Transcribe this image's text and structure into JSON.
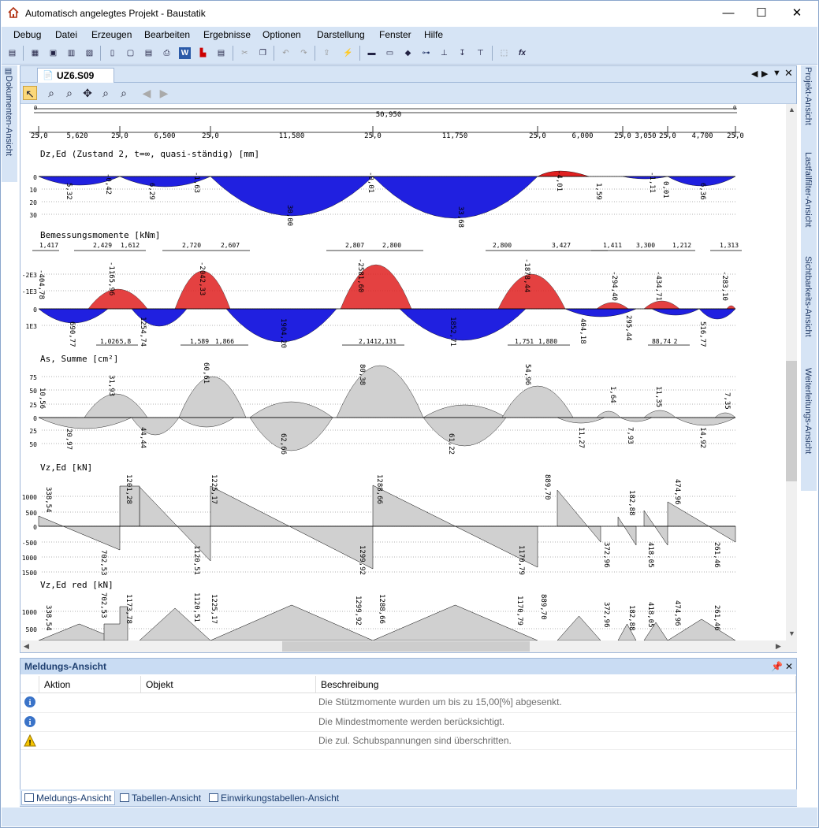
{
  "window": {
    "title": "Automatisch angelegtes Projekt - Baustatik",
    "minimize": "—",
    "maximize": "☐",
    "close": "✕"
  },
  "menu": [
    "Debug",
    "Datei",
    "Erzeugen",
    "Bearbeiten",
    "Ergebnisse",
    "Optionen",
    "Darstellung",
    "Fenster",
    "Hilfe"
  ],
  "side_tabs": {
    "left": "Dokumenten-Ansicht",
    "right": [
      "Projekt-Ansicht",
      "Lastfallfilter-Ansicht",
      "Sichtbarkeits-Ansicht",
      "Weiterleitungs-Ansicht"
    ]
  },
  "doc": {
    "tab": "UZ6.S09"
  },
  "diagram": {
    "span_total": "50,950",
    "spans": [
      "25,0",
      "5,620",
      "25,0",
      "6,500",
      "25,0",
      "11,580",
      "25,0",
      "11,750",
      "25,0",
      "6,000",
      "25,0",
      "3,050",
      "25,0",
      "4,700",
      "25,0"
    ],
    "dz": {
      "title": "Dz,Ed (Zustand 2, t=∞, quasi-ständig) [mm]",
      "ticks": [
        "0",
        "10",
        "20",
        "30"
      ],
      "labels": [
        "5,32",
        "-0,42",
        "6,29",
        "-1,63",
        "30,00",
        "-0,01",
        "33,68",
        "-4,01",
        "1,59",
        "-1,11",
        "0,01",
        "6,36"
      ]
    },
    "moment": {
      "title": "Bemessungsmomente [kNm]",
      "ticks": [
        "-2E3",
        "-1E3",
        "0",
        "1E3"
      ],
      "dims_top": [
        "1,417",
        "2,429",
        "1,612",
        "2,720",
        "2,607",
        "2,807",
        "2,800",
        "2,800",
        "3,427",
        "1,411",
        "3,300",
        "1,212",
        "1,313"
      ],
      "dims_bottom": [
        "1,026",
        "5,8",
        "1,589",
        "1,866",
        "2,141",
        "2,131",
        "1,751",
        "1,880",
        "88,74",
        "2"
      ],
      "labels": [
        "-404,78",
        "690,77",
        "-1165,96",
        "1254,74",
        "-2042,33",
        "1904,20",
        "-2581,60",
        "1852,71",
        "-1878,44",
        "404,18",
        "-294,40",
        "295,44",
        "-434,71",
        "516,77",
        "-283,10"
      ]
    },
    "as": {
      "title": "As, Summe [cm²]",
      "ticks": [
        "75",
        "50",
        "25",
        "0",
        "25",
        "50"
      ],
      "labels": [
        "10,56",
        "20,97",
        "31,93",
        "44,44",
        "60,61",
        "62,66",
        "80,38",
        "61,22",
        "54,96",
        "11,27",
        "1,64",
        "7,93",
        "11,35",
        "14,92",
        "7,35"
      ]
    },
    "vz": {
      "title": "Vz,Ed [kN]",
      "ticks": [
        "1000",
        "500",
        "0",
        "-500",
        "1000",
        "1500"
      ],
      "labels": [
        "338,54",
        "702,53",
        "1201,28",
        "1120,51",
        "1225,17",
        "1288,66",
        "1299,92",
        "889,70",
        "1170,79",
        "182,88",
        "372,96",
        "418,05",
        "474,96",
        "261,46"
      ]
    },
    "vzred": {
      "title": "Vz,Ed red [kN]",
      "ticks": [
        "1000",
        "500"
      ],
      "labels": [
        "338,54",
        "702,53",
        "1173,78",
        "1120,51",
        "1225,17",
        "1299,92",
        "1288,66",
        "1170,79",
        "889,70",
        "372,96",
        "182,88",
        "418,05",
        "474,96",
        "261,46"
      ]
    }
  },
  "messages": {
    "title": "Meldungs-Ansicht",
    "columns": [
      "Aktion",
      "Objekt",
      "Beschreibung"
    ],
    "rows": [
      {
        "icon": "info-icon",
        "text": "Die Stützmomente wurden um bis zu 15,00[%] abgesenkt."
      },
      {
        "icon": "info-icon",
        "text": "Die Mindestmomente werden berücksichtigt."
      },
      {
        "icon": "warning-icon",
        "text": "Die zul. Schubspannungen sind überschritten."
      }
    ]
  },
  "bottom_tabs": [
    "Meldungs-Ansicht",
    "Tabellen-Ansicht",
    "Einwirkungstabellen-Ansicht"
  ],
  "colors": {
    "accent": "#d6e4f5",
    "positive": "#2020e0",
    "negative": "#e02020",
    "shear": "#d0d0d0"
  }
}
